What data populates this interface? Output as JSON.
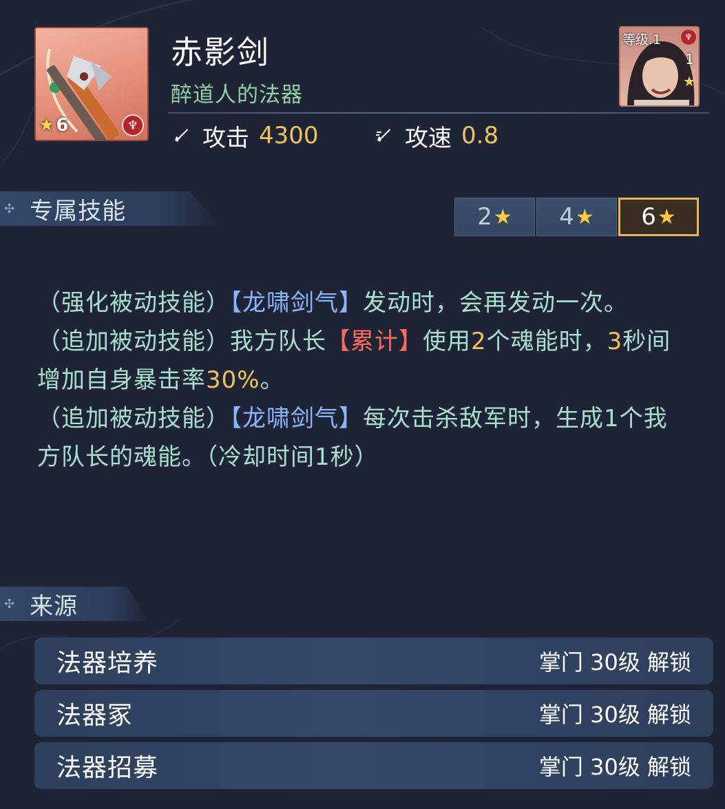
{
  "item": {
    "name": "赤影剑",
    "owner": "醉道人的法器",
    "stars": "6",
    "icon": "sword-icon",
    "sect_badge_icon": "sect-emblem-icon"
  },
  "stats": {
    "attack_label": "攻击",
    "attack_value": "4300",
    "speed_label": "攻速",
    "speed_value": "0.8"
  },
  "portrait": {
    "level_label": "等级.1",
    "count": "1"
  },
  "sections": {
    "skills_title": "专属技能",
    "source_title": "来源"
  },
  "star_tabs": [
    {
      "label": "2",
      "active": false
    },
    {
      "label": "4",
      "active": false
    },
    {
      "label": "6",
      "active": true
    }
  ],
  "description": {
    "p1_a": "（强化被动技能）",
    "p1_kw": "【龙啸剑气】",
    "p1_b": "发动时，会再发动一次。",
    "p2_a": "（追加被动技能）我方队长",
    "p2_kw": "【累计】",
    "p2_b": "使用",
    "p2_n1": "2",
    "p2_c": "个魂能时，",
    "p2_n2": "3",
    "p2_d": "秒间增加自身暴击率",
    "p2_n3": "30%",
    "p2_e": "。",
    "p3_a": "（追加被动技能）",
    "p3_kw": "【龙啸剑气】",
    "p3_b": "每次击杀敌军时，生成1个我方队长的魂能。（冷却时间1秒）"
  },
  "sources": [
    {
      "name": "法器培养",
      "requirement": "掌门 30级 解锁"
    },
    {
      "name": "法器冢",
      "requirement": "掌门 30级 解锁"
    },
    {
      "name": "法器招募",
      "requirement": "掌门 30级 解锁"
    }
  ],
  "colors": {
    "background": "#1e2435",
    "accent_gold": "#f0c35a",
    "owner_green": "#8fd0a6",
    "desc_teal": "#a7e0d0",
    "keyword_blue": "#8ab6ff",
    "keyword_red": "#ff6b5c",
    "active_tab_border": "#e6b55a"
  }
}
